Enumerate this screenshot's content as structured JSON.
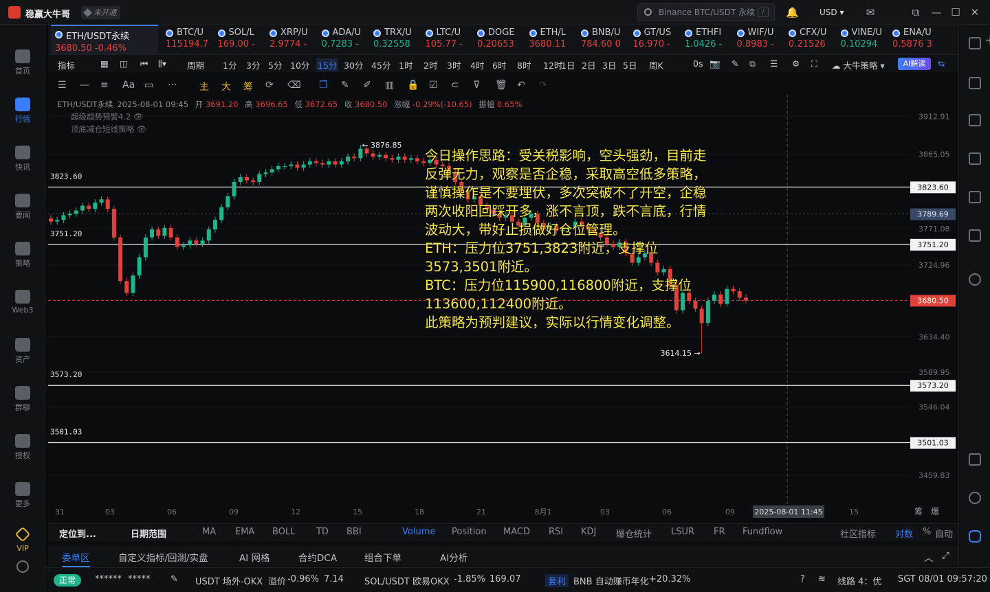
{
  "app": {
    "name": "稳赢大牛哥",
    "not_open": "未开通"
  },
  "titlebar": {
    "search_placeholder": "Binance BTC/USDT 永续",
    "search_kbd": "/",
    "currency": "USD"
  },
  "leftnav": [
    {
      "label": "首页"
    },
    {
      "label": "行情"
    },
    {
      "label": "快讯"
    },
    {
      "label": "要闻"
    },
    {
      "label": "策略"
    },
    {
      "label": "Web3"
    },
    {
      "label": "资产"
    },
    {
      "label": "群聊"
    },
    {
      "label": "授权"
    },
    {
      "label": "更多"
    },
    {
      "label": "VIP"
    }
  ],
  "tickers": [
    {
      "name": "ETH/USDT永续",
      "price": "3680.50",
      "change": "-0.46%",
      "dir": "down"
    },
    {
      "name": "BTC/U",
      "price": "115194.7",
      "dir": "down"
    },
    {
      "name": "SOL/L",
      "price": "169.00",
      "change": "-",
      "dir": "down"
    },
    {
      "name": "XRP/U",
      "price": "2.9774",
      "change": "-",
      "dir": "down"
    },
    {
      "name": "ADA/U",
      "price": "0.7283",
      "change": "-",
      "dir": "up"
    },
    {
      "name": "TRX/U",
      "price": "0.32558",
      "dir": "up"
    },
    {
      "name": "LTC/U",
      "price": "105.77",
      "change": "-",
      "dir": "down"
    },
    {
      "name": "DOGE",
      "price": "0.20653",
      "dir": "down"
    },
    {
      "name": "ETH/L",
      "price": "3680.11",
      "dir": "down"
    },
    {
      "name": "BNB/U",
      "price": "784.60",
      "change": "0",
      "dir": "down"
    },
    {
      "name": "GT/US",
      "price": "16.970",
      "change": "-",
      "dir": "down"
    },
    {
      "name": "ETHFI",
      "price": "1.0426",
      "change": "-",
      "dir": "up"
    },
    {
      "name": "WIF/U",
      "price": "0.8983",
      "change": "-",
      "dir": "down"
    },
    {
      "name": "CFX/U",
      "price": "0.21526",
      "dir": "down"
    },
    {
      "name": "VINE/U",
      "price": "0.10294",
      "dir": "up"
    },
    {
      "name": "ENA/U",
      "price": "0.5876",
      "change": "3",
      "dir": "down"
    }
  ],
  "timeframes": [
    "指标",
    "周期",
    "1分",
    "3分",
    "5分",
    "10分",
    "15分",
    "30分",
    "45分",
    "1时",
    "2时",
    "3时",
    "4时",
    "6时",
    "8时",
    "12时",
    "1日",
    "2日",
    "3日",
    "5日",
    "周K",
    "0s"
  ],
  "active_timeframe": "15分",
  "strategy_label": "大牛策略",
  "ai_label": "AI解读",
  "drawtools": [
    "主",
    "大",
    "筹"
  ],
  "legend": {
    "symbol": "ETH/USDT永续",
    "datetime": "2025-08-01 09:45",
    "open_label": "开",
    "open": "3691.20",
    "high_label": "高",
    "high": "3696.65",
    "low_label": "低",
    "low": "3672.65",
    "close_label": "收",
    "close": "3680.50",
    "chg_label": "涨幅",
    "chg": "-0.29%(-10.65)",
    "amp_label": "振幅",
    "amp": "0.65%",
    "ind1": "超级趋势预警4.2",
    "ind2": "顶底减仓短线策略"
  },
  "annotation": [
    "今日操作思路：受关税影响，空头强劲，目前走反弹无力，观察是否企稳，采取高空低多策略，谨慎操作是不要埋伏，多次突破不了开空，企稳两次收阳回踩开多，涨不言顶，跌不言底，行情波动大，带好止损做好仓位管理。",
    "ETH：压力位3751,3823附近，支撑位3573,3501附近。",
    "BTC：压力位115900,116800附近，支撑位113600,112400附近。",
    "此策略为预判建议，实际以行情变化调整。"
  ],
  "chart_data": {
    "type": "candlestick",
    "symbol": "ETH/USDT永续",
    "ylim": [
      3420,
      3940
    ],
    "y_ticks": [
      "3912.91",
      "3865.05",
      "3771.08",
      "3724.96",
      "3634.40",
      "3589.95",
      "3546.04",
      "3459.83"
    ],
    "x_ticks": [
      "31",
      "03",
      "06",
      "09",
      "12",
      "15",
      "18",
      "21",
      "8月1",
      "03",
      "06",
      "09",
      "15"
    ],
    "x_cursor_label": "2025-08-01 11:45",
    "levels": [
      {
        "price": "3823.60",
        "label": "3823.60"
      },
      {
        "price": "3751.20",
        "label": "3751.20"
      },
      {
        "price": "3573.20",
        "label": "3573.20"
      },
      {
        "price": "3501.03",
        "label": "3501.03"
      }
    ],
    "level_axis_labels": [
      "3823.60",
      "3751.20",
      "3573.20",
      "3501.03"
    ],
    "crosshair_price": "3789.69",
    "last_price": "3680.50",
    "high_mark": "3876.85",
    "low_mark": "3614.15",
    "axis_corner": [
      "筹",
      "爆"
    ],
    "closes": [
      3780,
      3782,
      3788,
      3790,
      3794,
      3800,
      3796,
      3804,
      3808,
      3796,
      3760,
      3705,
      3690,
      3712,
      3735,
      3760,
      3770,
      3762,
      3772,
      3760,
      3748,
      3750,
      3756,
      3752,
      3756,
      3770,
      3782,
      3798,
      3812,
      3830,
      3836,
      3832,
      3830,
      3840,
      3842,
      3846,
      3850,
      3850,
      3852,
      3848,
      3852,
      3856,
      3854,
      3852,
      3856,
      3852,
      3856,
      3862,
      3860,
      3872,
      3866,
      3862,
      3864,
      3860,
      3858,
      3862,
      3858,
      3860,
      3856,
      3854,
      3858,
      3852,
      3850,
      3842,
      3830,
      3818,
      3808,
      3812,
      3800,
      3795,
      3790,
      3785,
      3788,
      3780,
      3775,
      3785,
      3790,
      3778,
      3770,
      3775,
      3768,
      3770,
      3772,
      3780,
      3775,
      3770,
      3766,
      3760,
      3752,
      3748,
      3754,
      3740,
      3728,
      3735,
      3740,
      3728,
      3716,
      3720,
      3700,
      3668,
      3690,
      3680,
      3670,
      3652,
      3680,
      3688,
      3676,
      3695,
      3692,
      3684,
      3680.5
    ]
  },
  "bottom_tabs": [
    "定位到...",
    "日期范围",
    "MA",
    "EMA",
    "BOLL",
    "TD",
    "BBI",
    "Volume",
    "Position",
    "MACD",
    "RSI",
    "KDJ",
    "爆仓统计",
    "LSUR",
    "FR",
    "Fundflow",
    "社区指标",
    "对数",
    "%",
    "自动"
  ],
  "panel_tabs": [
    "委单区",
    "自定义指标/回测/实盘",
    "AI 网格",
    "合约DCA",
    "组合下单",
    "AI分析"
  ],
  "status": {
    "ok": "正常",
    "hidden1": "******",
    "hidden2": "*****",
    "otc_label": "USDT 场外-OKX",
    "otc_premium_label": "溢价",
    "otc_premium": "-0.96%",
    "otc_price": "7.14",
    "sol_label": "SOL/USDT 欧易OKX",
    "sol_chg": "-1.85%",
    "sol_price": "169.07",
    "arb_label": "套利",
    "bnb_label": "BNB 自动赚币年化",
    "bnb_apy": "+20.32%",
    "line_label": "线路 4：优",
    "clock": "SGT 08/01 09:57:20"
  }
}
